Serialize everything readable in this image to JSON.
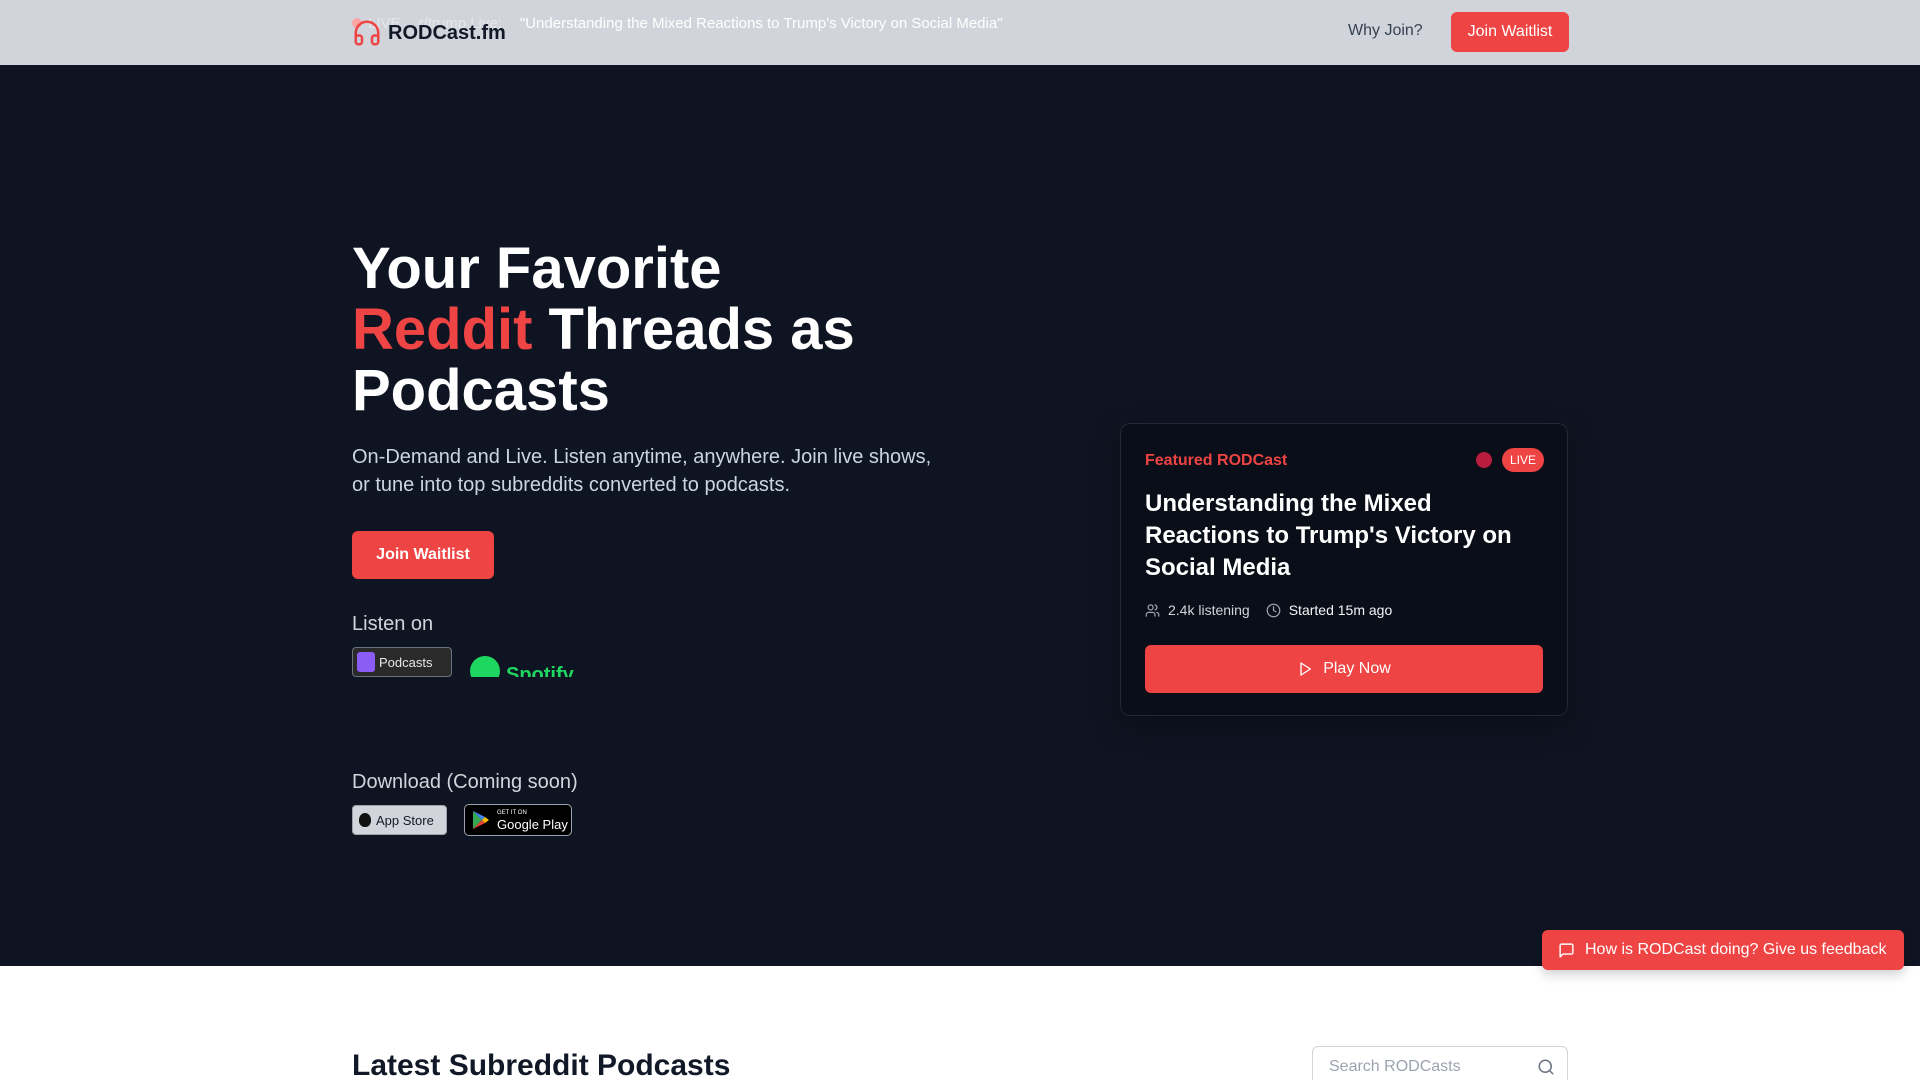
{
  "header": {
    "ticker": {
      "live_label": "LIVE",
      "source_label": "r/trump Live:",
      "title": "\"Understanding the Mixed Reactions to Trump's Victory on Social Media\""
    },
    "brand_name": "RODCast.fm",
    "nav_why": "Why Join?",
    "nav_join": "Join Waitlist"
  },
  "hero": {
    "title_line1": "Your Favorite",
    "title_accent": "Reddit",
    "title_line2_rest": " Threads as",
    "title_line3": "Podcasts",
    "subtitle": "On-Demand and Live. Listen anytime, anywhere. Join live shows, or tune into top subreddits converted to podcasts.",
    "cta": "Join Waitlist",
    "listen_label": "Listen on",
    "apple_podcasts": "Podcasts",
    "spotify": "Spotify",
    "download_label": "Download (Coming soon)",
    "app_store": "App Store",
    "google_play_small": "GET IT ON",
    "google_play_big": "Google Play"
  },
  "featured": {
    "label": "Featured RODCast",
    "live_badge": "LIVE",
    "title": "Understanding the Mixed Reactions to Trump's Victory on Social Media",
    "listeners": "2.4k listening",
    "started": "Started 15m ago",
    "play_label": "Play Now"
  },
  "feedback": {
    "label": "How is RODCast doing? Give us feedback"
  },
  "latest": {
    "title": "Latest Subreddit Podcasts",
    "search_placeholder": "Search RODCasts"
  },
  "colors": {
    "accent": "#ef4444",
    "hero_bg": "#0f1422",
    "header_bg": "#d1d5db"
  }
}
